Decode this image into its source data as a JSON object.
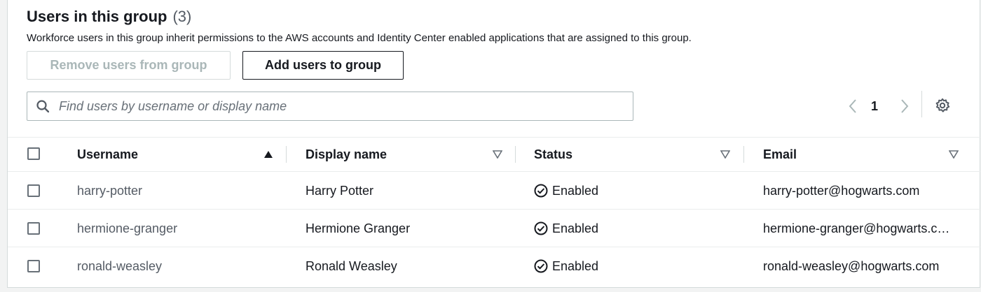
{
  "section": {
    "title": "Users in this group",
    "count": "(3)",
    "description": "Workforce users in this group inherit permissions to the AWS accounts and Identity Center enabled applications that are assigned to this group."
  },
  "actions": {
    "remove_label": "Remove users from group",
    "add_label": "Add users to group"
  },
  "search": {
    "placeholder": "Find users by username or display name",
    "value": ""
  },
  "pagination": {
    "current_page": "1"
  },
  "table": {
    "columns": [
      "Username",
      "Display name",
      "Status",
      "Email"
    ],
    "sorted_column": "Username",
    "rows": [
      {
        "username": "harry-potter",
        "display_name": "Harry Potter",
        "status": "Enabled",
        "email": "harry-potter@hogwarts.com"
      },
      {
        "username": "hermione-granger",
        "display_name": "Hermione Granger",
        "status": "Enabled",
        "email": "hermione-granger@hogwarts.com"
      },
      {
        "username": "ronald-weasley",
        "display_name": "Ronald Weasley",
        "status": "Enabled",
        "email": "ronald-weasley@hogwarts.com"
      }
    ]
  },
  "icons": {
    "search": "search-icon",
    "prev": "chevron-left-icon",
    "next": "chevron-right-icon",
    "settings": "gear-icon",
    "sort_asc": "sort-ascending-icon",
    "sort_neutral": "sort-neutral-icon",
    "status_ok": "check-circle-icon"
  },
  "colors": {
    "text": "#16191f",
    "muted": "#545b64",
    "disabled": "#aab7b8",
    "border": "#d5dbdb"
  }
}
